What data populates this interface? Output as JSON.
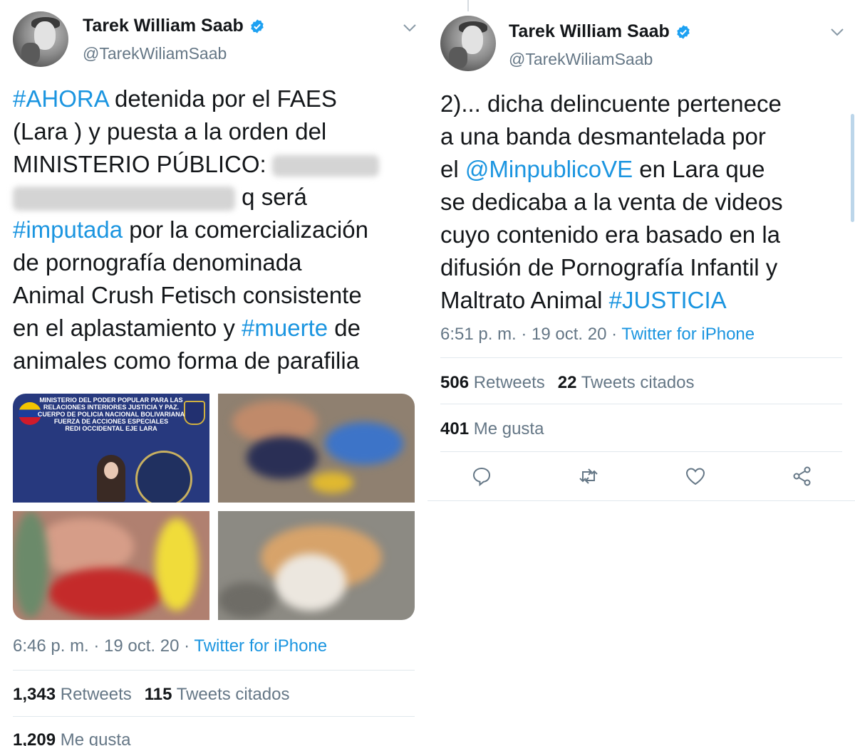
{
  "tweet_left": {
    "author_name": "Tarek William Saab",
    "author_handle": "@TarekWiliamSaab",
    "body_line_1": {
      "tag": "#AHORA",
      "rest": " detenida por el FAES"
    },
    "body_line_2": "(Lara ) y puesta a la orden del",
    "body_line_3": "MINISTERIO PÚBLICO:",
    "body_line_4_after_blur": " q será",
    "body_line_5": {
      "tag": "#imputada",
      "rest": " por la comercialización"
    },
    "body_line_6": "de pornografía denominada",
    "body_line_7": "Animal Crush  Fetisch consistente",
    "body_line_8": {
      "pre": "en el aplastamiento y ",
      "tag": "#muerte",
      "rest": " de"
    },
    "body_line_9": "animales como forma de parafilia",
    "media_poster": {
      "lines": [
        "MINISTERIO DEL PODER POPULAR PARA LAS",
        "RELACIONES INTERIORES JUSTICIA Y PAZ.",
        "CUERPO DE POLICIA NACIONAL BOLIVARIANA",
        "FUERZA DE ACCIONES ESPECIALES",
        "REDI OCCIDENTAL EJE LARA"
      ]
    },
    "timestamp": "6:46 p. m. · 19 oct. 20 · ",
    "source": "Twitter for iPhone",
    "retweets_count": "1,343",
    "retweets_label": " Retweets",
    "quotes_count": "115",
    "quotes_label": " Tweets citados",
    "likes_count": "1,209",
    "likes_label": " Me gusta"
  },
  "tweet_right": {
    "author_name": "Tarek William Saab",
    "author_handle": "@TarekWiliamSaab",
    "body_line_1": "2)... dicha delincuente pertenece",
    "body_line_2": "a una banda desmantelada por",
    "body_line_3": {
      "pre": "el ",
      "mention": "@MinpublicoVE",
      "rest": " en Lara que"
    },
    "body_line_4": "se dedicaba a la venta de videos",
    "body_line_5": "cuyo contenido era basado en la",
    "body_line_6": "difusión de Pornografía Infantil y",
    "body_line_7": {
      "pre": "Maltrato Animal ",
      "tag": "#JUSTICIA"
    },
    "timestamp": "6:51 p. m. · 19 oct. 20 · ",
    "source": "Twitter for iPhone",
    "retweets_count": "506",
    "retweets_label": " Retweets",
    "quotes_count": "22",
    "quotes_label": " Tweets citados",
    "likes_count": "401",
    "likes_label": " Me gusta"
  },
  "icons": {
    "verified": "verified-badge-icon",
    "caret": "chevron-down-icon",
    "reply": "reply-icon",
    "retweet": "retweet-icon",
    "like": "heart-icon",
    "share": "share-icon"
  },
  "colors": {
    "link": "#1b95e0",
    "text": "#14171a",
    "secondary": "#657786",
    "divider": "#e1e8ed"
  }
}
